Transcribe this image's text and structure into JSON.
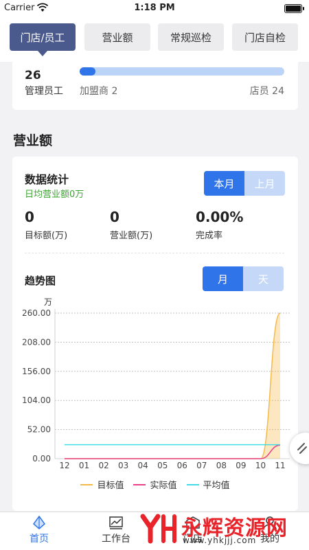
{
  "status_bar": {
    "carrier": "Carrier",
    "time": "1:18 PM"
  },
  "tabs": [
    {
      "label": "门店/员工"
    },
    {
      "label": "营业额"
    },
    {
      "label": "常规巡检"
    },
    {
      "label": "门店自检"
    }
  ],
  "staff": {
    "count": "26",
    "label": "管理员工",
    "franchisee": "加盟商 2",
    "clerk": "店员 24",
    "progress_fraction": 0.077
  },
  "revenue": {
    "section_title": "营业额",
    "stats_title": "数据统计",
    "daily_avg": "日均营业额0万",
    "period_toggle": {
      "current": "本月",
      "last": "上月"
    },
    "metrics": [
      {
        "value": "0",
        "label": "目标额(万)"
      },
      {
        "value": "0",
        "label": "营业额(万)"
      },
      {
        "value": "0.00%",
        "label": "完成率"
      }
    ],
    "trend_title": "趋势图",
    "trend_toggle": {
      "month": "月",
      "day": "天"
    }
  },
  "chart_data": {
    "type": "line",
    "unit_label": "万",
    "categories": [
      "12",
      "01",
      "02",
      "03",
      "04",
      "05",
      "06",
      "07",
      "08",
      "09",
      "10",
      "11"
    ],
    "ylim": [
      0,
      260
    ],
    "yticks": [
      "260.00",
      "208.00",
      "156.00",
      "104.00",
      "52.00",
      "0.00"
    ],
    "series": [
      {
        "name": "目标值",
        "color": "#f5b94a",
        "values": [
          0,
          0,
          0,
          0,
          0,
          0,
          0,
          0,
          0,
          0,
          0,
          260
        ]
      },
      {
        "name": "实际值",
        "color": "#e8408a",
        "values": [
          0,
          0,
          0,
          0,
          0,
          0,
          0,
          0,
          0,
          0,
          0,
          24
        ]
      },
      {
        "name": "平均值",
        "color": "#3fdbe8",
        "values": [
          25,
          25,
          25,
          25,
          25,
          25,
          25,
          25,
          25,
          25,
          25,
          25
        ]
      }
    ]
  },
  "bottom_nav": [
    {
      "label": "首页"
    },
    {
      "label": "工作台"
    },
    {
      "label": "门店"
    },
    {
      "label": "我的"
    }
  ],
  "watermark": {
    "text": "永辉资源网",
    "url": "www.yhkjjj.com"
  }
}
